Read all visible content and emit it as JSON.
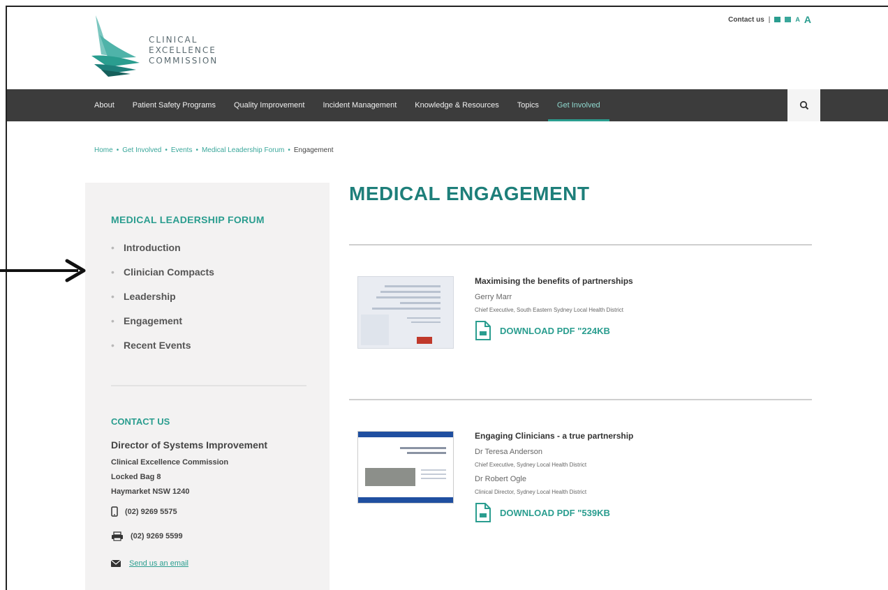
{
  "logo": {
    "lines": [
      "CLINICAL",
      "EXCELLENCE",
      "COMMISSION"
    ]
  },
  "toplinks": {
    "contact": "Contact us",
    "separator": "|",
    "small_a": "A",
    "big_a": "A"
  },
  "nav": {
    "items": [
      "About",
      "Patient Safety Programs",
      "Quality Improvement",
      "Incident Management",
      "Knowledge & Resources",
      "Topics",
      "Get Involved"
    ],
    "active": "Get Involved"
  },
  "breadcrumb": [
    "Home",
    "Get Involved",
    "Events",
    "Medical Leadership Forum",
    "Engagement"
  ],
  "sidebar": {
    "title": "MEDICAL LEADERSHIP FORUM",
    "items": [
      "Introduction",
      "Clinician Compacts",
      "Leadership",
      "Engagement",
      "Recent Events"
    ],
    "contact": {
      "title": "CONTACT US",
      "name": "Director of Systems Improvement",
      "org": "Clinical Excellence Commission",
      "address1": "Locked Bag 8",
      "address2": "Haymarket NSW 1240",
      "phone": "(02) 9269 5575",
      "fax": "(02) 9269 5599",
      "email_label": "Send us an email"
    }
  },
  "main": {
    "title": "MEDICAL ENGAGEMENT",
    "docs": [
      {
        "title": "Maximising the benefits of partnerships",
        "people": [
          {
            "name": "Gerry Marr",
            "role": "Chief Executive, South Eastern Sydney Local Health District"
          }
        ],
        "download": "DOWNLOAD PDF \"224KB"
      },
      {
        "title": "Engaging Clinicians - a true partnership",
        "people": [
          {
            "name": "Dr Teresa Anderson",
            "role": "Chief Executive, Sydney Local Health District"
          },
          {
            "name": "Dr Robert Ogle",
            "role": "Clinical Director, Sydney Local Health District"
          }
        ],
        "download": "DOWNLOAD PDF \"539KB"
      }
    ]
  },
  "colors": {
    "accent": "#2a9d8f",
    "nav_bg": "#3c3c3c",
    "sidebar_bg": "#f3f2f2",
    "title": "#1e7f7a"
  }
}
